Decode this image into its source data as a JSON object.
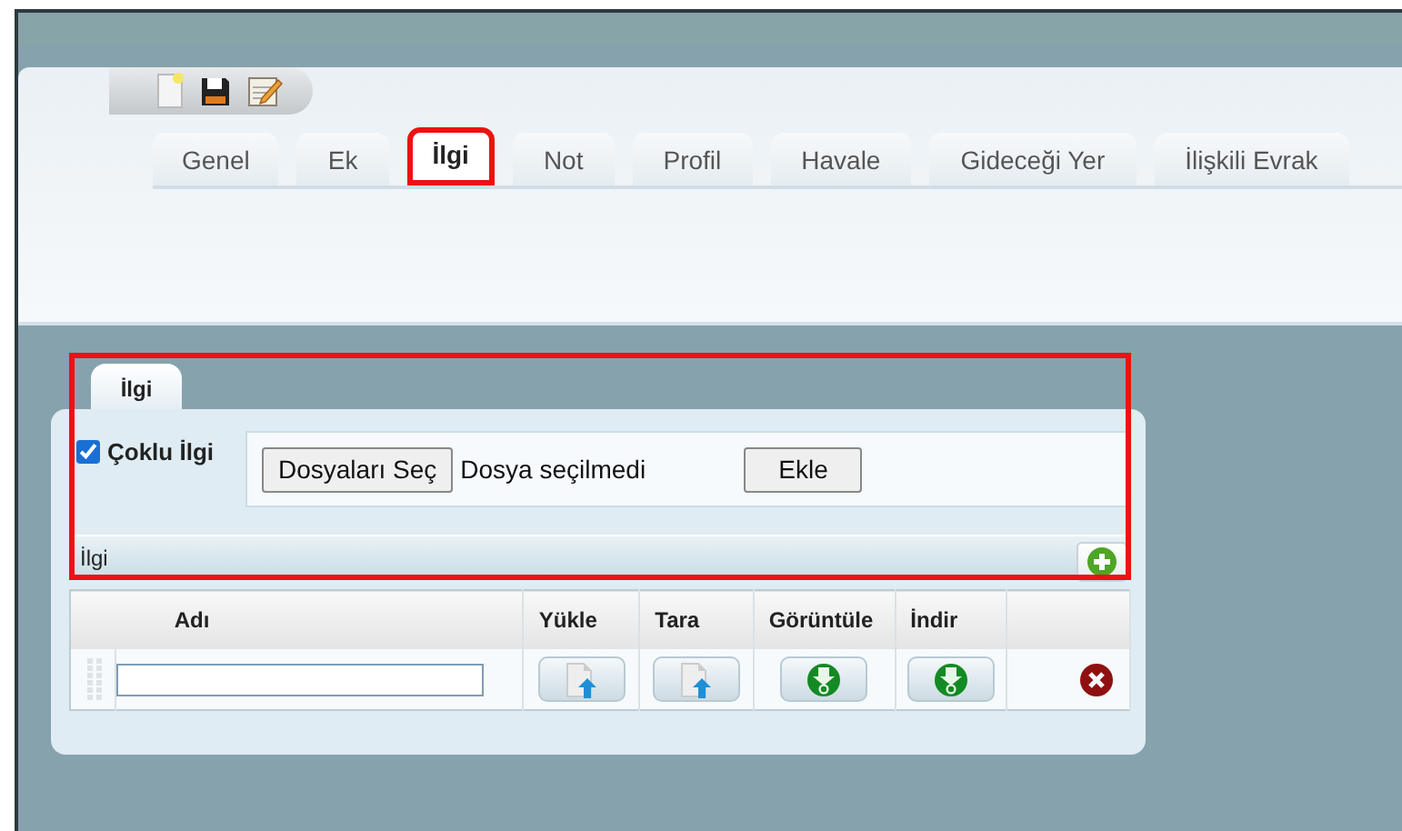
{
  "toolbar": [
    {
      "kind": "new"
    },
    {
      "kind": "save"
    },
    {
      "kind": "edit"
    }
  ],
  "tabs": [
    {
      "label": "Genel",
      "selected": false,
      "highlighted": false
    },
    {
      "label": "Ek",
      "selected": false,
      "highlighted": false
    },
    {
      "label": "İlgi",
      "selected": true,
      "highlighted": true
    },
    {
      "label": "Not",
      "selected": false,
      "highlighted": false
    },
    {
      "label": "Profil",
      "selected": false,
      "highlighted": false
    },
    {
      "label": "Havale",
      "selected": false,
      "highlighted": false
    },
    {
      "label": "Gideceği Yer",
      "selected": false,
      "highlighted": false
    },
    {
      "label": "İlişkili Evrak",
      "selected": false,
      "highlighted": false
    }
  ],
  "section": {
    "tab": "İlgi",
    "highlighted": true,
    "multi": {
      "label": "Çoklu İlgi",
      "checked": true
    },
    "file_button": "Dosyaları Seç",
    "file_status": "Dosya seçilmedi",
    "add_button": "Ekle"
  },
  "grid": {
    "title": "İlgi",
    "columns": [
      "Adı",
      "Yükle",
      "Tara",
      "Görüntüle",
      "İndir"
    ],
    "rows": [
      {
        "cells": [
          {
            "kind": "input"
          },
          {
            "kind": "upload"
          },
          {
            "kind": "upload"
          },
          {
            "kind": "download"
          },
          {
            "kind": "download"
          },
          {
            "kind": "delete"
          }
        ]
      }
    ]
  }
}
